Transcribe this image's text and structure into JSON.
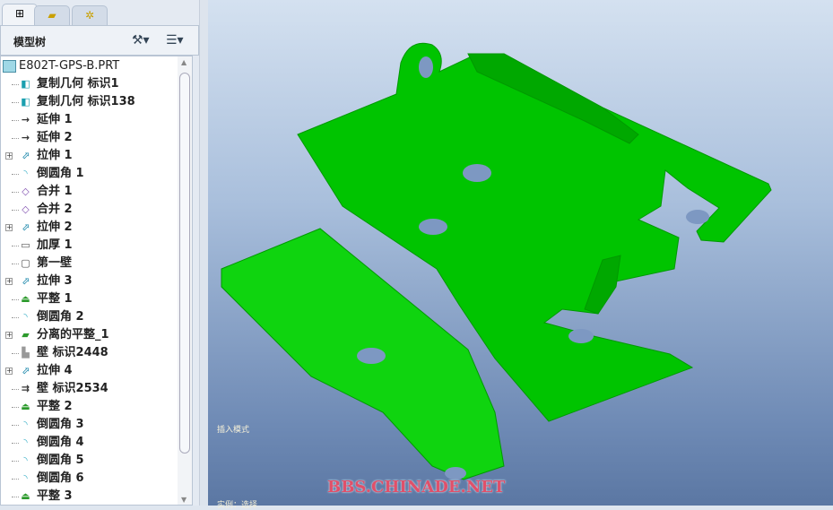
{
  "tabs": [
    {
      "icon": "model-tree-icon"
    },
    {
      "icon": "folders-icon"
    },
    {
      "icon": "favorites-folder-icon"
    }
  ],
  "panel": {
    "title": "模型树"
  },
  "tree": {
    "root": "E802T-GPS-B.PRT",
    "items": [
      {
        "label": "复制几何 标识1",
        "icon": "copy-geometry-icon",
        "expand": false
      },
      {
        "label": "复制几何 标识138",
        "icon": "copy-geometry-icon",
        "expand": false
      },
      {
        "label": "延伸 1",
        "icon": "extend-icon",
        "expand": false
      },
      {
        "label": "延伸 2",
        "icon": "extend-icon",
        "expand": false
      },
      {
        "label": "拉伸 1",
        "icon": "extrude-icon",
        "expand": true
      },
      {
        "label": "倒圆角 1",
        "icon": "round-icon",
        "expand": false
      },
      {
        "label": "合并 1",
        "icon": "merge-icon",
        "expand": false
      },
      {
        "label": "合并 2",
        "icon": "merge-icon",
        "expand": false
      },
      {
        "label": "拉伸 2",
        "icon": "extrude-icon",
        "expand": true
      },
      {
        "label": "加厚 1",
        "icon": "thicken-icon",
        "expand": false
      },
      {
        "label": "第一壁",
        "icon": "first-wall-icon",
        "expand": false
      },
      {
        "label": "拉伸 3",
        "icon": "extrude-icon",
        "expand": true
      },
      {
        "label": "平整 1",
        "icon": "flat-icon",
        "expand": false
      },
      {
        "label": "倒圆角 2",
        "icon": "round-icon",
        "expand": false
      },
      {
        "label": "分离的平整_1",
        "icon": "unattached-flat-icon",
        "expand": true
      },
      {
        "label": "壁 标识2448",
        "icon": "wall-icon",
        "expand": false
      },
      {
        "label": "拉伸 4",
        "icon": "extrude-icon",
        "expand": true
      },
      {
        "label": "壁 标识2534",
        "icon": "wall-flange-icon",
        "expand": false
      },
      {
        "label": "平整 2",
        "icon": "flat-icon",
        "expand": false
      },
      {
        "label": "倒圆角 3",
        "icon": "round-icon",
        "expand": false
      },
      {
        "label": "倒圆角 4",
        "icon": "round-icon",
        "expand": false
      },
      {
        "label": "倒圆角 5",
        "icon": "round-icon",
        "expand": false
      },
      {
        "label": "倒圆角 6",
        "icon": "round-icon",
        "expand": false
      },
      {
        "label": "平整 3",
        "icon": "flat-icon",
        "expand": false
      }
    ]
  },
  "viewport": {
    "message1": "插入模式",
    "message2": "实例：选择",
    "watermark": "BBS.CHINADE.NET",
    "part_color": "#00cc00"
  }
}
